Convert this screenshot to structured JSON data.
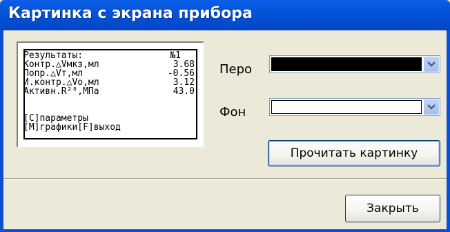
{
  "window": {
    "title": "Картинка с экрана прибора"
  },
  "screen": {
    "lines": [
      {
        "label": "Результаты:",
        "value": "№1"
      },
      {
        "label": "Контр.△Vмкз,мл",
        "value": "3.68"
      },
      {
        "label": "Попр.△Vт,мл",
        "value": "-0.56"
      },
      {
        "label": "И.контр.△Vo,мл",
        "value": "3.12"
      },
      {
        "label": "Активн.R²⁸,МПа",
        "value": "43.0"
      }
    ],
    "footer_line1": "[C]параметры",
    "footer_line2": "[M]графики[F]выход"
  },
  "pen": {
    "label": "Перо",
    "color": "#000000"
  },
  "background": {
    "label": "Фон",
    "color": "#ffffff"
  },
  "buttons": {
    "read_picture": "Прочитать картинку",
    "close": "Закрыть"
  },
  "icons": {
    "pen_dropdown": "chevron-down-icon",
    "background_dropdown": "chevron-down-icon"
  }
}
